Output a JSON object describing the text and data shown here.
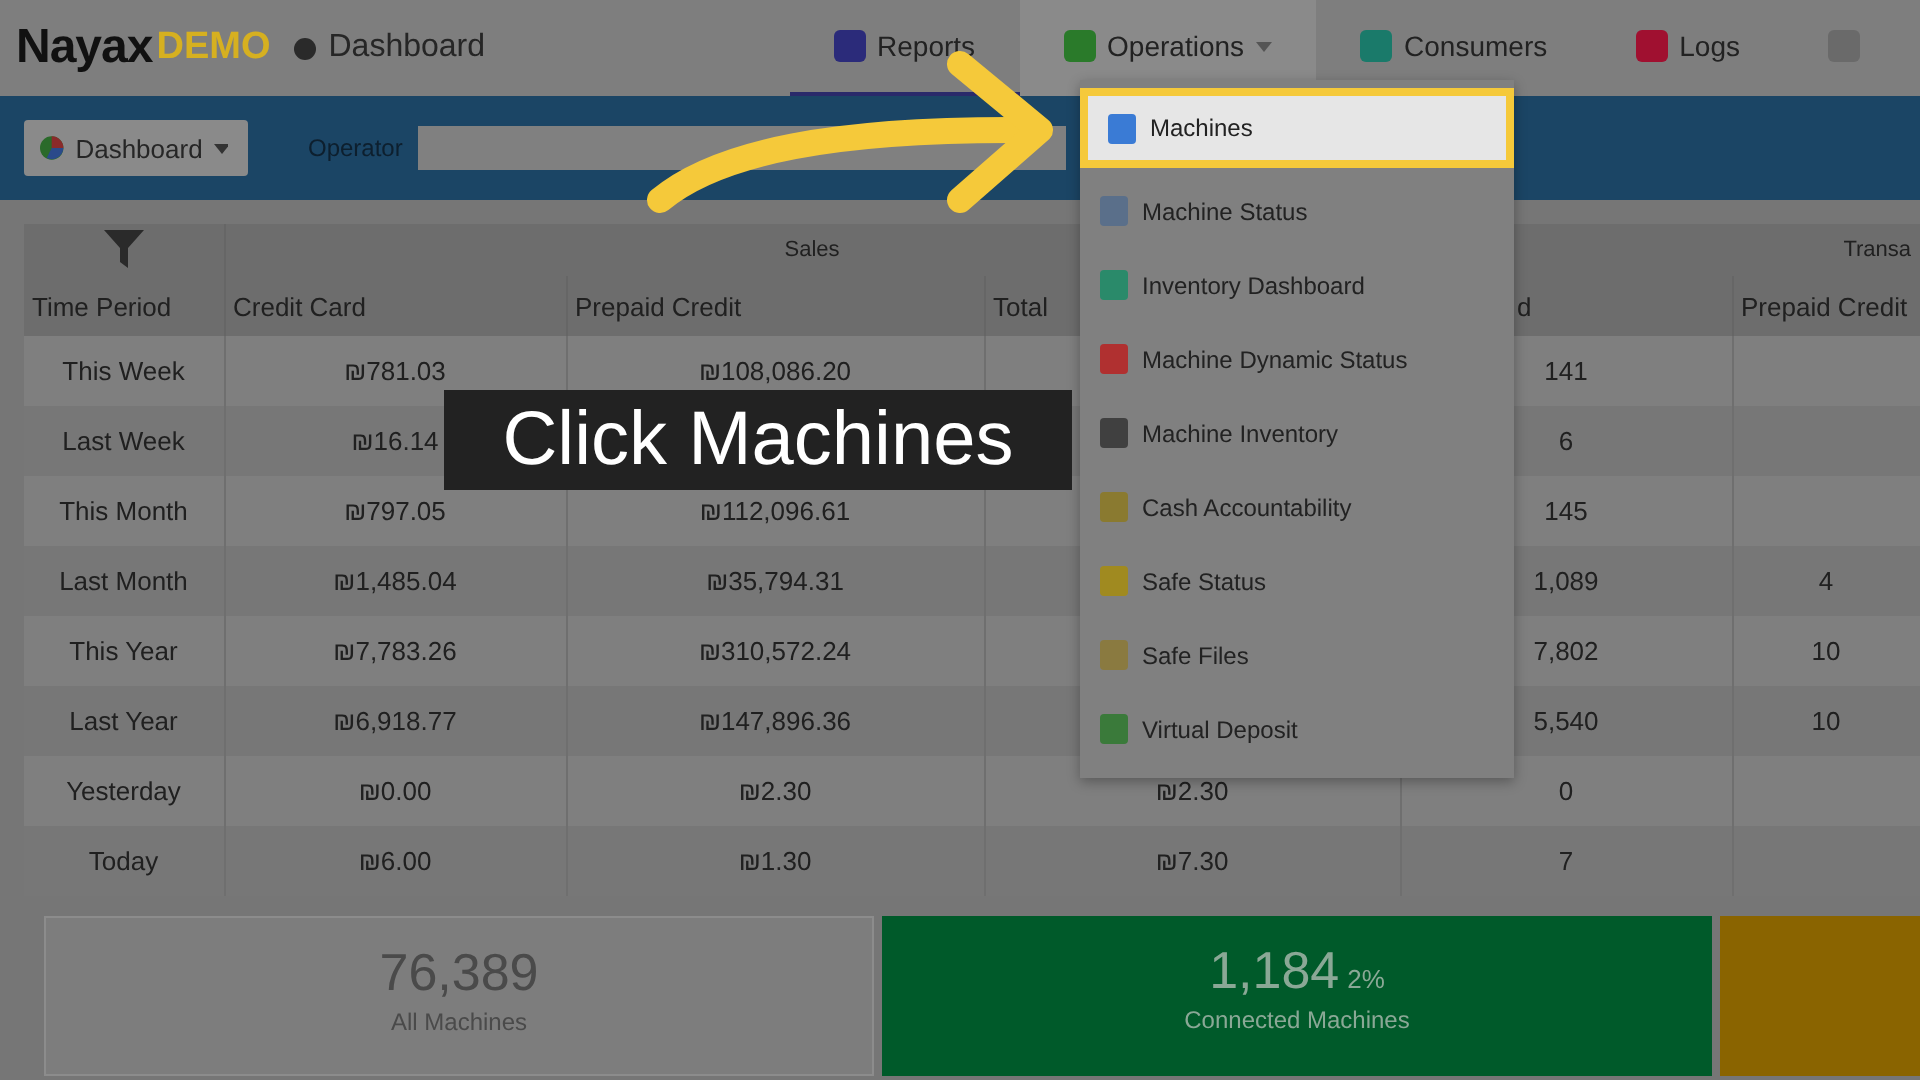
{
  "header": {
    "logo": "Nayax",
    "logo_badge": "DEMO",
    "page_title": "Dashboard"
  },
  "nav": [
    {
      "kind": "tab",
      "label": "Reports",
      "selected": true,
      "open": false
    },
    {
      "kind": "tab",
      "label": "Operations",
      "selected": false,
      "open": true
    },
    {
      "kind": "tab",
      "label": "Consumers",
      "selected": false,
      "open": false
    },
    {
      "kind": "tab",
      "label": "Logs",
      "selected": false,
      "open": false
    },
    {
      "kind": "icon",
      "selected": false,
      "open": false
    }
  ],
  "toolbar": {
    "view_select": "Dashboard",
    "operator_label": "Operator"
  },
  "table": {
    "groups": [
      {
        "label": "Sales",
        "columns": [
          "Credit Card",
          "Prepaid Credit",
          "Total"
        ]
      },
      {
        "label": "Transa",
        "columns": [
          "d",
          "Prepaid Credit"
        ]
      }
    ],
    "first_column": "Time Period",
    "rows": [
      {
        "time_period": "This Week",
        "credit_card": "₪781.03",
        "prepaid_credit": "₪108,086.20",
        "tx_credit_card": "141"
      },
      {
        "time_period": "Last Week",
        "credit_card": "₪16.14",
        "tx_credit_card": "6"
      },
      {
        "time_period": "This Month",
        "credit_card": "₪797.05",
        "prepaid_credit": "₪112,096.61",
        "tx_credit_card": "145"
      },
      {
        "time_period": "Last Month",
        "credit_card": "₪1,485.04",
        "prepaid_credit": "₪35,794.31",
        "tx_credit_card": "1,089",
        "tx_prepaid_credit": "4"
      },
      {
        "time_period": "This Year",
        "credit_card": "₪7,783.26",
        "prepaid_credit": "₪310,572.24",
        "tx_credit_card": "7,802",
        "tx_prepaid_credit": "10"
      },
      {
        "time_period": "Last Year",
        "credit_card": "₪6,918.77",
        "prepaid_credit": "₪147,896.36",
        "tx_credit_card": "5,540",
        "tx_prepaid_credit": "10"
      },
      {
        "time_period": "Yesterday",
        "credit_card": "₪0.00",
        "prepaid_credit": "₪2.30",
        "total": "₪2.30",
        "tx_credit_card": "0"
      },
      {
        "time_period": "Today",
        "credit_card": "₪6.00",
        "prepaid_credit": "₪1.30",
        "total": "₪7.30",
        "tx_credit_card": "7"
      }
    ]
  },
  "menu": {
    "items": [
      {
        "label": "Machines",
        "selected": true,
        "color": "#3a7bd5"
      },
      {
        "label": "Machine Status",
        "selected": false,
        "color": "#5a6f8a"
      },
      {
        "label": "Inventory Dashboard",
        "selected": false,
        "color": "#2a8a6a"
      },
      {
        "label": "Machine Dynamic Status",
        "selected": false,
        "color": "#b03030"
      },
      {
        "label": "Machine Inventory",
        "selected": false,
        "color": "#404040"
      },
      {
        "label": "Cash Accountability",
        "selected": false,
        "color": "#8a7a30"
      },
      {
        "label": "Safe Status",
        "selected": false,
        "color": "#a08a20"
      },
      {
        "label": "Safe Files",
        "selected": false,
        "color": "#8a7a40"
      },
      {
        "label": "Virtual Deposit",
        "selected": false,
        "color": "#3a7a3a"
      }
    ]
  },
  "cards": [
    {
      "kind": "neutral",
      "value": "76,389",
      "label": "All Machines"
    },
    {
      "kind": "connected",
      "value": "1,184",
      "percent": "2%",
      "label": "Connected Machines"
    },
    {
      "kind": "warning"
    }
  ],
  "caption": "Click Machines"
}
